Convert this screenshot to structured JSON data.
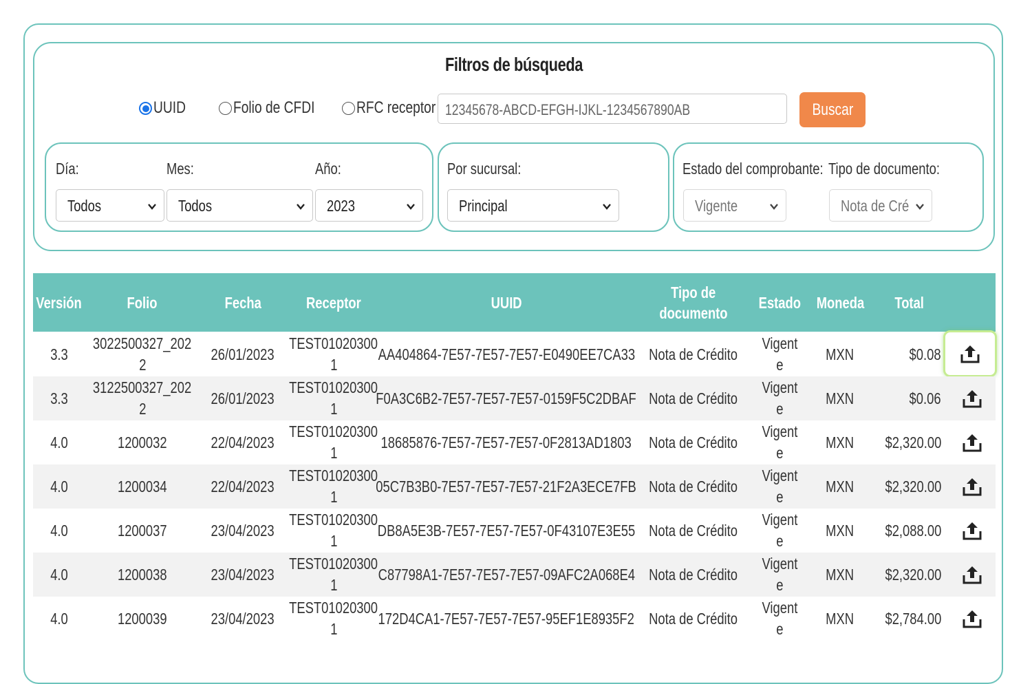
{
  "filters": {
    "title": "Filtros de búsqueda",
    "radios": [
      {
        "label": "UUID",
        "checked": true
      },
      {
        "label": "Folio de CFDI",
        "checked": false
      },
      {
        "label": "RFC receptor",
        "checked": false
      }
    ],
    "search_value": "12345678-ABCD-EFGH-IJKL-1234567890AB",
    "search_button": "Buscar",
    "date": {
      "day_label": "Día:",
      "day_value": "Todos",
      "month_label": "Mes:",
      "month_value": "Todos",
      "year_label": "Año:",
      "year_value": "2023"
    },
    "branch": {
      "label": "Por sucursal:",
      "value": "Principal"
    },
    "status": {
      "label": "Estado del comprobante:",
      "value": "Vigente"
    },
    "doc_type": {
      "label": "Tipo de documento:",
      "value": "Nota de Cré"
    }
  },
  "table": {
    "headers": {
      "version": "Versión",
      "folio": "Folio",
      "fecha": "Fecha",
      "receptor": "Receptor",
      "uuid": "UUID",
      "tipo_1": "Tipo de",
      "tipo_2": "documento",
      "estado": "Estado",
      "moneda": "Moneda",
      "total": "Total"
    },
    "rows": [
      {
        "version": "3.3",
        "folio_1": "3022500327_202",
        "folio_2": "2",
        "fecha": "26/01/2023",
        "receptor_1": "TEST01020300",
        "receptor_2": "1",
        "uuid": "AA404864-7E57-7E57-7E57-E0490EE7CA33",
        "tipo": "Nota de Crédito",
        "estado_1": "Vigent",
        "estado_2": "e",
        "moneda": "MXN",
        "total": "$0.08"
      },
      {
        "version": "3.3",
        "folio_1": "3122500327_202",
        "folio_2": "2",
        "fecha": "26/01/2023",
        "receptor_1": "TEST01020300",
        "receptor_2": "1",
        "uuid": "F0A3C6B2-7E57-7E57-7E57-0159F5C2DBAF",
        "tipo": "Nota de Crédito",
        "estado_1": "Vigent",
        "estado_2": "e",
        "moneda": "MXN",
        "total": "$0.06"
      },
      {
        "version": "4.0",
        "folio_1": "1200032",
        "folio_2": "",
        "fecha": "22/04/2023",
        "receptor_1": "TEST01020300",
        "receptor_2": "1",
        "uuid": "18685876-7E57-7E57-7E57-0F2813AD1803",
        "tipo": "Nota de Crédito",
        "estado_1": "Vigent",
        "estado_2": "e",
        "moneda": "MXN",
        "total": "$2,320.00"
      },
      {
        "version": "4.0",
        "folio_1": "1200034",
        "folio_2": "",
        "fecha": "22/04/2023",
        "receptor_1": "TEST01020300",
        "receptor_2": "1",
        "uuid": "05C7B3B0-7E57-7E57-7E57-21F2A3ECE7FB",
        "tipo": "Nota de Crédito",
        "estado_1": "Vigent",
        "estado_2": "e",
        "moneda": "MXN",
        "total": "$2,320.00"
      },
      {
        "version": "4.0",
        "folio_1": "1200037",
        "folio_2": "",
        "fecha": "23/04/2023",
        "receptor_1": "TEST01020300",
        "receptor_2": "1",
        "uuid": "DB8A5E3B-7E57-7E57-7E57-0F43107E3E55",
        "tipo": "Nota de Crédito",
        "estado_1": "Vigent",
        "estado_2": "e",
        "moneda": "MXN",
        "total": "$2,088.00"
      },
      {
        "version": "4.0",
        "folio_1": "1200038",
        "folio_2": "",
        "fecha": "23/04/2023",
        "receptor_1": "TEST01020300",
        "receptor_2": "1",
        "uuid": "C87798A1-7E57-7E57-7E57-09AFC2A068E4",
        "tipo": "Nota de Crédito",
        "estado_1": "Vigent",
        "estado_2": "e",
        "moneda": "MXN",
        "total": "$2,320.00"
      },
      {
        "version": "4.0",
        "folio_1": "1200039",
        "folio_2": "",
        "fecha": "23/04/2023",
        "receptor_1": "TEST01020300",
        "receptor_2": "1",
        "uuid": "172D4CA1-7E57-7E57-7E57-95EF1E8935F2",
        "tipo": "Nota de Crédito",
        "estado_1": "Vigent",
        "estado_2": "e",
        "moneda": "MXN",
        "total": "$2,784.00"
      }
    ]
  },
  "icons": {
    "row_action": "upload-icon",
    "select_arrow": "chevron-down-icon"
  },
  "colors": {
    "accent": "#6cc3bb",
    "button": "#f0884a",
    "focus": "#c6ec92",
    "radio": "#1a73e8"
  }
}
